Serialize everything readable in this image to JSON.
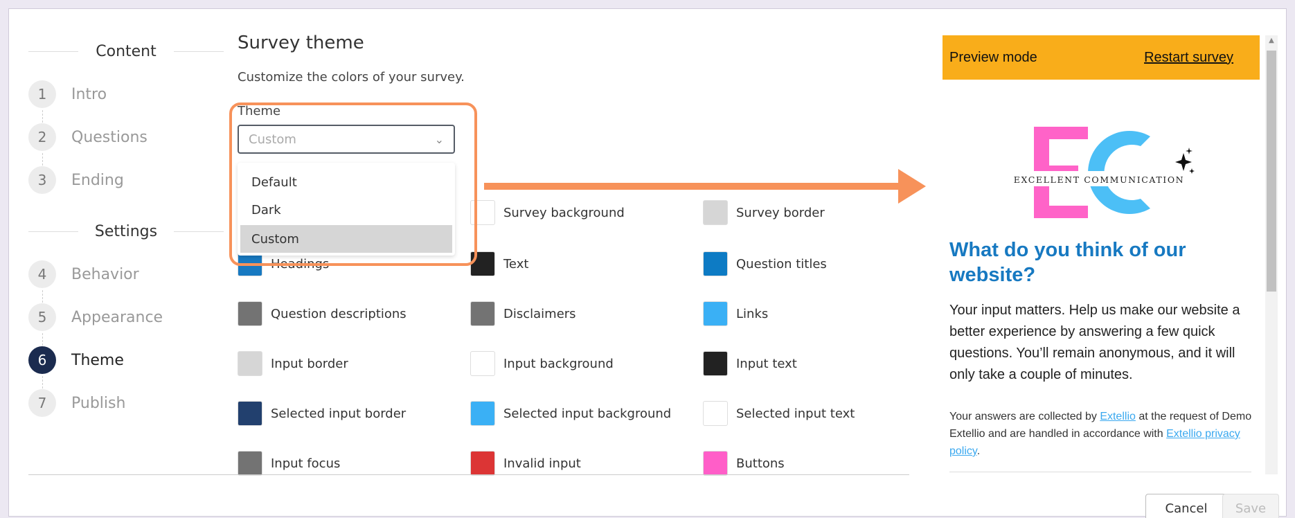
{
  "nav": {
    "content_heading": "Content",
    "settings_heading": "Settings",
    "steps": [
      {
        "num": "1",
        "label": "Intro"
      },
      {
        "num": "2",
        "label": "Questions"
      },
      {
        "num": "3",
        "label": "Ending"
      },
      {
        "num": "4",
        "label": "Behavior"
      },
      {
        "num": "5",
        "label": "Appearance"
      },
      {
        "num": "6",
        "label": "Theme"
      },
      {
        "num": "7",
        "label": "Publish"
      }
    ]
  },
  "main": {
    "title": "Survey theme",
    "subtitle": "Customize the colors of your survey.",
    "theme_label": "Theme",
    "theme_placeholder": "Custom",
    "dropdown_options": [
      "Default",
      "Dark",
      "Custom"
    ],
    "dropdown_selected": "Custom",
    "colors": [
      {
        "label": "Survey background",
        "color": "#ffffff"
      },
      {
        "label": "Survey border",
        "color": "#d6d6d6"
      },
      {
        "label": "Headings",
        "color": "#1779c1"
      },
      {
        "label": "Text",
        "color": "#222222"
      },
      {
        "label": "Question titles",
        "color": "#0d7bc4"
      },
      {
        "label": "Question descriptions",
        "color": "#737373"
      },
      {
        "label": "Disclaimers",
        "color": "#737373"
      },
      {
        "label": "Links",
        "color": "#3ab0f5"
      },
      {
        "label": "Input border",
        "color": "#d6d6d6"
      },
      {
        "label": "Input background",
        "color": "#ffffff"
      },
      {
        "label": "Input text",
        "color": "#222222"
      },
      {
        "label": "Selected input border",
        "color": "#22406e"
      },
      {
        "label": "Selected input background",
        "color": "#3ab0f5"
      },
      {
        "label": "Selected input text",
        "color": "#ffffff"
      },
      {
        "label": "Input focus",
        "color": "#737373"
      },
      {
        "label": "Invalid input",
        "color": "#dc3535"
      },
      {
        "label": "Buttons",
        "color": "#ff5ec8"
      }
    ]
  },
  "preview": {
    "mode_label": "Preview mode",
    "restart_label": "Restart survey",
    "logo_text": "EXCELLENT COMMUNICATION",
    "question_title": "What do you think of our website?",
    "question_description": "Your input matters. Help us make our website a better experience by answering a few quick questions. You’ll remain anonymous, and it will only take a couple of minutes.",
    "disclaimer_part1": "Your answers are collected by ",
    "disclaimer_link1": "Extellio",
    "disclaimer_part2": " at the request of Demo Extellio and are handled in accordance with ",
    "disclaimer_link2": "Extellio privacy policy",
    "disclaimer_part3": "."
  },
  "footer": {
    "cancel_label": "Cancel",
    "save_label": "Save"
  },
  "accent": {
    "highlight": "#f7925a",
    "preview_bar": "#f9ad1a",
    "active_step": "#1b2b4f"
  }
}
